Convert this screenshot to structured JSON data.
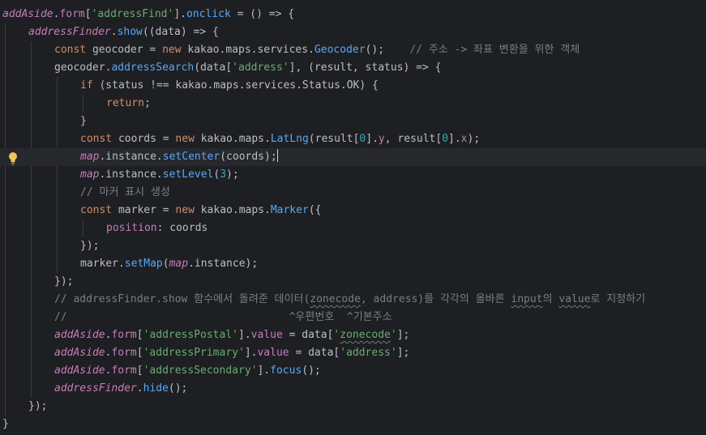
{
  "editor": {
    "lines": [
      [
        [
          "addAside",
          "gvar"
        ],
        [
          ".",
          "id"
        ],
        [
          "form",
          "field"
        ],
        [
          "[",
          "id"
        ],
        [
          "'addressFind'",
          "str"
        ],
        [
          "].",
          "id"
        ],
        [
          "onclick",
          "fn"
        ],
        [
          " = () => {",
          "id"
        ]
      ],
      [
        [
          "addressFinder",
          "gvar"
        ],
        [
          ".",
          "id"
        ],
        [
          "show",
          "fn"
        ],
        [
          "((data) => {",
          "id"
        ]
      ],
      [
        [
          "const",
          "kw"
        ],
        [
          " geocoder = ",
          "id"
        ],
        [
          "new",
          "kw"
        ],
        [
          " kakao.maps.services.",
          "id"
        ],
        [
          "Geocoder",
          "cls"
        ],
        [
          "();    ",
          "id"
        ],
        [
          "// 주소 -> 좌표 변환을 위한 객체",
          "cm"
        ]
      ],
      [
        [
          "geocoder.",
          "id"
        ],
        [
          "addressSearch",
          "fn"
        ],
        [
          "(data[",
          "id"
        ],
        [
          "'address'",
          "str"
        ],
        [
          "], (result, status) => {",
          "id"
        ]
      ],
      [
        [
          "if",
          "kw"
        ],
        [
          " (status !== kakao.maps.services.Status.OK) {",
          "id"
        ]
      ],
      [
        [
          "return",
          "kw"
        ],
        [
          ";",
          "id"
        ]
      ],
      [
        [
          "}",
          "id"
        ]
      ],
      [
        [
          "const",
          "kw"
        ],
        [
          " coords = ",
          "id"
        ],
        [
          "new",
          "kw"
        ],
        [
          " kakao.maps.",
          "id"
        ],
        [
          "LatLng",
          "cls"
        ],
        [
          "(result[",
          "id"
        ],
        [
          "0",
          "num"
        ],
        [
          "].",
          "id"
        ],
        [
          "y",
          "field"
        ],
        [
          ", result[",
          "id"
        ],
        [
          "0",
          "num"
        ],
        [
          "].",
          "id"
        ],
        [
          "x",
          "field"
        ],
        [
          ");",
          "id"
        ]
      ],
      [
        [
          "map",
          "lvar"
        ],
        [
          ".instance.",
          "id"
        ],
        [
          "setCenter",
          "fn"
        ],
        [
          "(coords);",
          "id"
        ]
      ],
      [
        [
          "map",
          "lvar"
        ],
        [
          ".instance.",
          "id"
        ],
        [
          "setLevel",
          "fn"
        ],
        [
          "(",
          "id"
        ],
        [
          "3",
          "num"
        ],
        [
          ");",
          "id"
        ]
      ],
      [
        [
          "// 마커 표시 생성",
          "cm"
        ]
      ],
      [
        [
          "const",
          "kw"
        ],
        [
          " marker = ",
          "id"
        ],
        [
          "new",
          "kw"
        ],
        [
          " kakao.maps.",
          "id"
        ],
        [
          "Marker",
          "cls"
        ],
        [
          "({",
          "id"
        ]
      ],
      [
        [
          "position",
          "field"
        ],
        [
          ": coords",
          "id"
        ]
      ],
      [
        [
          "});",
          "id"
        ]
      ],
      [
        [
          "marker.",
          "id"
        ],
        [
          "setMap",
          "fn"
        ],
        [
          "(",
          "id"
        ],
        [
          "map",
          "lvar"
        ],
        [
          ".instance);",
          "id"
        ]
      ],
      [
        [
          "});",
          "id"
        ]
      ],
      [
        [
          "// addressFinder.show 함수에서 돌려준 데이터(",
          "cm"
        ],
        [
          "zonecode",
          "cm",
          "wavy"
        ],
        [
          ", address)를 각각의 올바른 ",
          "cm"
        ],
        [
          "input",
          "cm",
          "wavy"
        ],
        [
          "의 ",
          "cm"
        ],
        [
          "value",
          "cm",
          "wavy"
        ],
        [
          "로 지정하기",
          "cm"
        ]
      ],
      [
        [
          "//                                   ^우편번호  ^기본주소",
          "cm"
        ]
      ],
      [
        [
          "addAside",
          "gvar"
        ],
        [
          ".",
          "id"
        ],
        [
          "form",
          "field"
        ],
        [
          "[",
          "id"
        ],
        [
          "'addressPostal'",
          "str"
        ],
        [
          "].",
          "id"
        ],
        [
          "value",
          "field"
        ],
        [
          " = data[",
          "id"
        ],
        [
          "'",
          "str"
        ],
        [
          "zonecode",
          "str",
          "wavy"
        ],
        [
          "'",
          "str"
        ],
        [
          "];",
          "id"
        ]
      ],
      [
        [
          "addAside",
          "gvar"
        ],
        [
          ".",
          "id"
        ],
        [
          "form",
          "field"
        ],
        [
          "[",
          "id"
        ],
        [
          "'addressPrimary'",
          "str"
        ],
        [
          "].",
          "id"
        ],
        [
          "value",
          "field"
        ],
        [
          " = data[",
          "id"
        ],
        [
          "'address'",
          "str"
        ],
        [
          "];",
          "id"
        ]
      ],
      [
        [
          "addAside",
          "gvar"
        ],
        [
          ".",
          "id"
        ],
        [
          "form",
          "field"
        ],
        [
          "[",
          "id"
        ],
        [
          "'addressSecondary'",
          "str"
        ],
        [
          "].",
          "id"
        ],
        [
          "focus",
          "fn"
        ],
        [
          "();",
          "id"
        ]
      ],
      [
        [
          "addressFinder",
          "gvar"
        ],
        [
          ".",
          "id"
        ],
        [
          "hide",
          "fn"
        ],
        [
          "();",
          "id"
        ]
      ],
      [
        [
          "});",
          "id"
        ]
      ],
      [
        [
          "}",
          "id"
        ]
      ]
    ],
    "indents": [
      0,
      1,
      2,
      2,
      3,
      4,
      3,
      3,
      3,
      3,
      3,
      3,
      4,
      3,
      3,
      2,
      2,
      2,
      2,
      2,
      2,
      2,
      1,
      0
    ],
    "caret_line": 8,
    "caret_after": 3,
    "intention_icon": "lightbulb-icon"
  }
}
